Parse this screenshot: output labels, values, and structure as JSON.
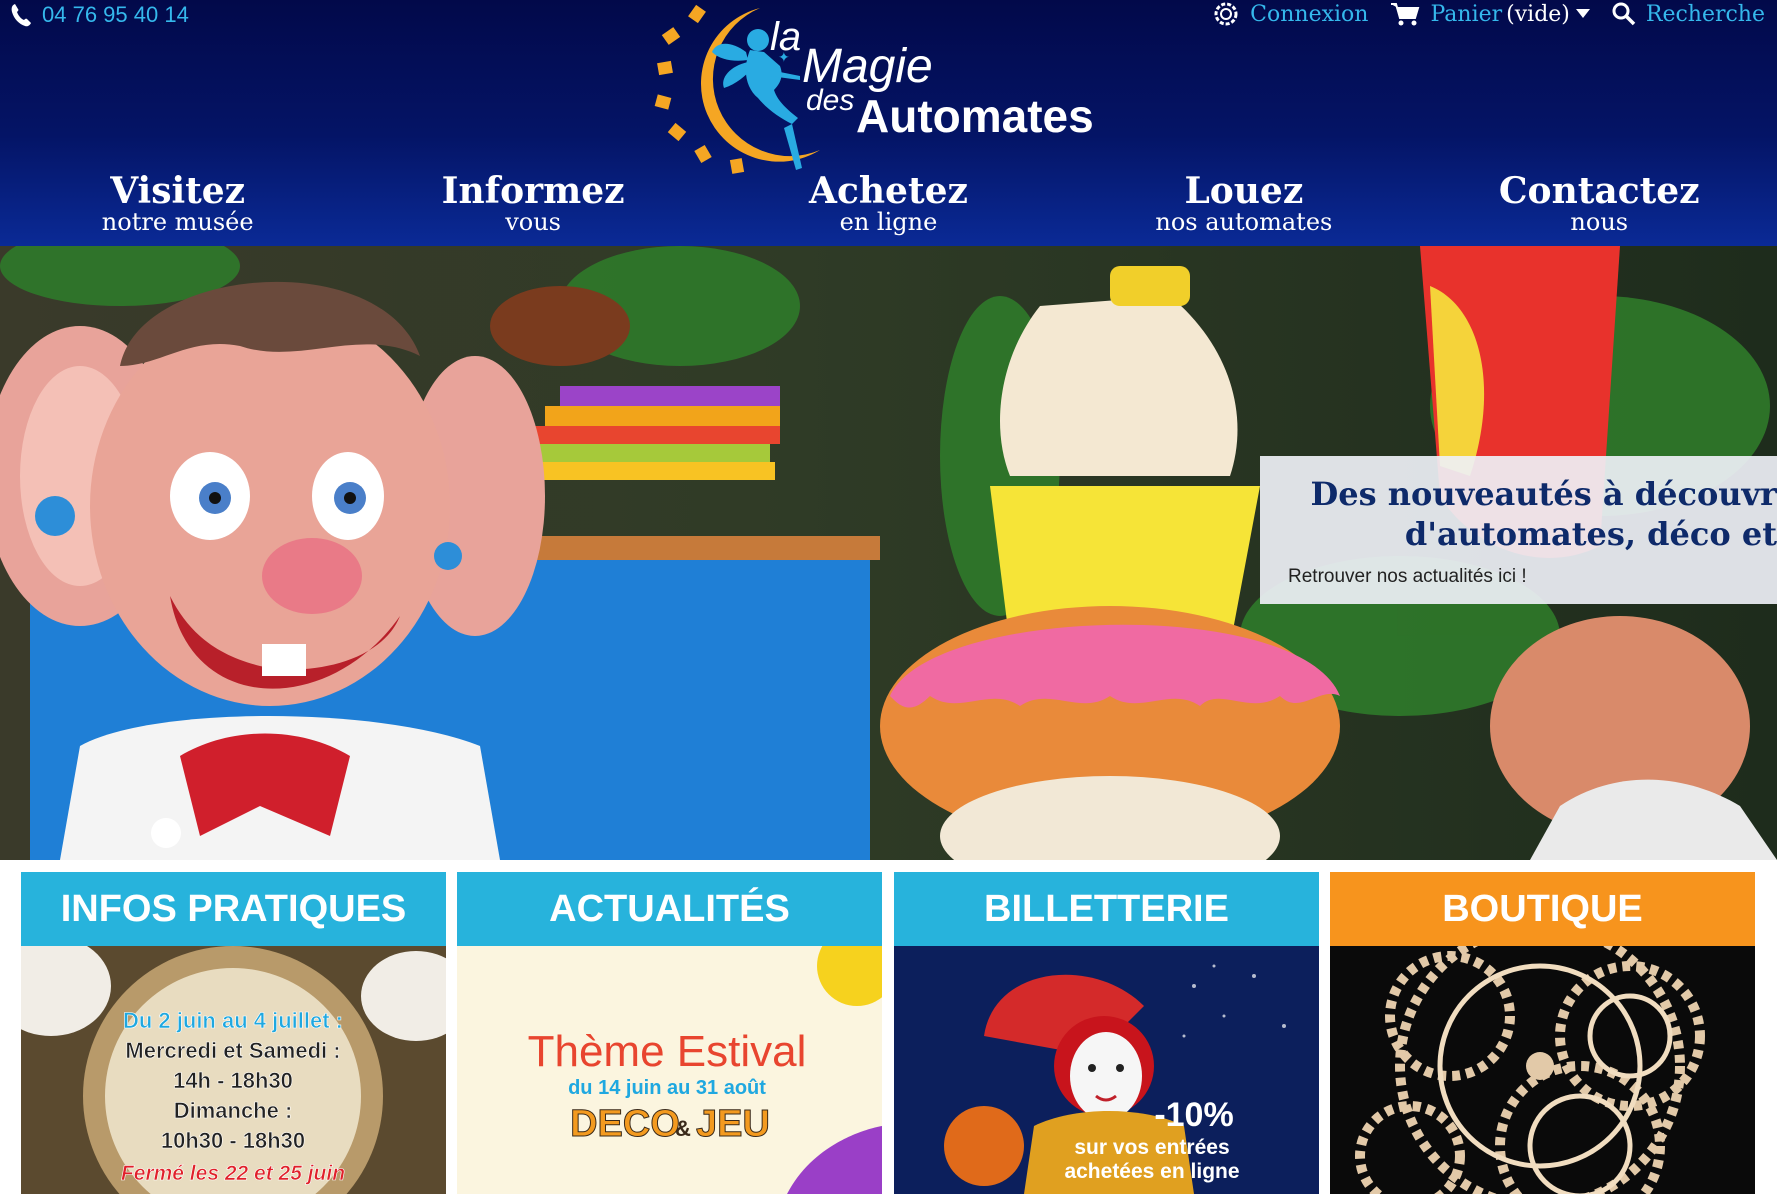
{
  "header": {
    "phone": "04 76 95 40 14",
    "login_label": "Connexion",
    "cart_label": "Panier",
    "cart_status": "(vide)",
    "search_label": "Recherche",
    "logo": {
      "line1": "la",
      "line2": "Magie",
      "line3": "des",
      "line4": "Automates"
    }
  },
  "nav": [
    {
      "title": "Visitez",
      "subtitle": "notre musée"
    },
    {
      "title": "Informez",
      "subtitle": "vous"
    },
    {
      "title": "Achetez",
      "subtitle": "en ligne"
    },
    {
      "title": "Louez",
      "subtitle": "nos automates"
    },
    {
      "title": "Contactez",
      "subtitle": "nous"
    }
  ],
  "hero": {
    "caption_title": "Des nouveautés à découvr\nd'automates, déco et",
    "caption_link": "Retrouver nos actualités ici !"
  },
  "cards": [
    {
      "title": "INFOS PRATIQUES",
      "lines": [
        "Du 2 juin au 4 juillet :",
        "Mercredi et Samedi :",
        "14h - 18h30",
        "Dimanche  :",
        "10h30 - 18h30",
        "Fermé les 22 et 25 juin"
      ]
    },
    {
      "title": "ACTUALITÉS",
      "lines": [
        "Thème Estival",
        "du 14 juin au 31 août",
        "DECO",
        "&",
        "JEU"
      ]
    },
    {
      "title": "BILLETTERIE",
      "lines": [
        "-10%",
        "sur vos entrées",
        "achetées en ligne"
      ]
    },
    {
      "title": "BOUTIQUE",
      "lines": []
    }
  ],
  "colors": {
    "header_bg": "#041466",
    "accent_blue": "#35b8ec",
    "card_blue": "#27b3dc",
    "card_orange": "#f7941d",
    "caption_text": "#0e2a6a"
  }
}
